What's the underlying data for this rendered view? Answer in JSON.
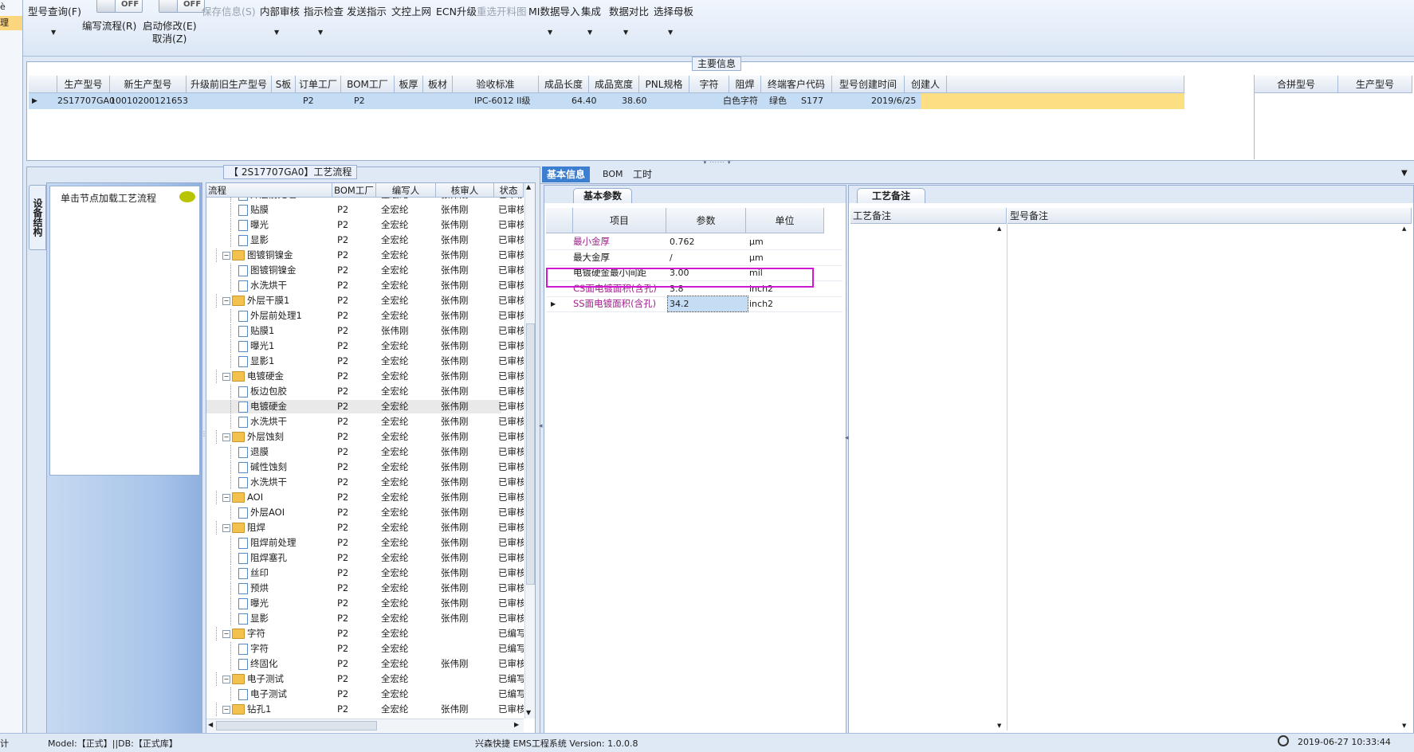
{
  "left_strip": {
    "items": [
      "è",
      "理"
    ]
  },
  "toolbar": {
    "items": [
      {
        "label": "型号查询(F)",
        "has_dropdown": true
      },
      {
        "label": "编写流程(R)"
      },
      {
        "label": "启动修改(E)",
        "sublabel": "取消(Z)"
      },
      {
        "label": "保存信息(S)",
        "disabled": true
      },
      {
        "label": "内部审核",
        "has_dropdown": true
      },
      {
        "label": "指示检查",
        "has_dropdown": true
      },
      {
        "label": "发送指示"
      },
      {
        "label": "文控上网"
      },
      {
        "label": "ECN升级"
      },
      {
        "label": "重选开料图",
        "disabled": true
      },
      {
        "label": "MI数据导入",
        "has_dropdown": true
      },
      {
        "label": "集成",
        "has_dropdown": true
      },
      {
        "label": "数据对比",
        "has_dropdown": true
      },
      {
        "label": "选择母板",
        "has_dropdown": true
      }
    ],
    "toggle1": "OFF",
    "toggle2": "OFF"
  },
  "main_info": {
    "title": "主要信息",
    "headers": [
      "生产型号",
      "新生产型号",
      "升级前旧生产型号",
      "S板",
      "订单工厂",
      "BOM工厂",
      "板厚",
      "板材",
      "验收标准",
      "成品长度",
      "成品宽度",
      "PNL规格",
      "字符",
      "阻焊",
      "终端客户代码",
      "型号创建时间",
      "创建人"
    ],
    "row": [
      "2S17707GA0",
      "10010200121653",
      "",
      "",
      "P2",
      "P2",
      "",
      "",
      "IPC-6012 II级",
      "64.40",
      "38.60",
      "",
      "白色字符",
      "绿色",
      "S177",
      "2019/6/25",
      ""
    ],
    "right_headers": [
      "合拼型号",
      "生产型号"
    ]
  },
  "process": {
    "title": "【 2S17707GA0】工艺流程",
    "side_tab": "设备结构",
    "load_hint": "单击节点加载工艺流程",
    "headers": [
      "流程",
      "BOM工厂",
      "编写人",
      "核审人",
      "状态"
    ],
    "rows": [
      {
        "name": "外层前处理",
        "level": 2,
        "bom": "P2",
        "writer": "全宏纶",
        "reviewer": "张伟刚",
        "status": "已审核"
      },
      {
        "name": "贴膜",
        "level": 2,
        "bom": "P2",
        "writer": "全宏纶",
        "reviewer": "张伟刚",
        "status": "已审核"
      },
      {
        "name": "曝光",
        "level": 2,
        "bom": "P2",
        "writer": "全宏纶",
        "reviewer": "张伟刚",
        "status": "已审核"
      },
      {
        "name": "显影",
        "level": 2,
        "bom": "P2",
        "writer": "全宏纶",
        "reviewer": "张伟刚",
        "status": "已审核"
      },
      {
        "name": "图镀铜镍金",
        "level": 1,
        "bom": "P2",
        "writer": "全宏纶",
        "reviewer": "张伟刚",
        "status": "已审核"
      },
      {
        "name": "图镀铜镍金",
        "level": 2,
        "bom": "P2",
        "writer": "全宏纶",
        "reviewer": "张伟刚",
        "status": "已审核"
      },
      {
        "name": "水洗烘干",
        "level": 2,
        "bom": "P2",
        "writer": "全宏纶",
        "reviewer": "张伟刚",
        "status": "已审核"
      },
      {
        "name": "外层干膜1",
        "level": 1,
        "bom": "P2",
        "writer": "全宏纶",
        "reviewer": "张伟刚",
        "status": "已审核"
      },
      {
        "name": "外层前处理1",
        "level": 2,
        "bom": "P2",
        "writer": "全宏纶",
        "reviewer": "张伟刚",
        "status": "已审核"
      },
      {
        "name": "贴膜1",
        "level": 2,
        "bom": "P2",
        "writer": "张伟刚",
        "reviewer": "张伟刚",
        "status": "已审核"
      },
      {
        "name": "曝光1",
        "level": 2,
        "bom": "P2",
        "writer": "全宏纶",
        "reviewer": "张伟刚",
        "status": "已审核"
      },
      {
        "name": "显影1",
        "level": 2,
        "bom": "P2",
        "writer": "全宏纶",
        "reviewer": "张伟刚",
        "status": "已审核"
      },
      {
        "name": "电镀硬金",
        "level": 1,
        "bom": "P2",
        "writer": "全宏纶",
        "reviewer": "张伟刚",
        "status": "已审核"
      },
      {
        "name": "板边包胶",
        "level": 2,
        "bom": "P2",
        "writer": "全宏纶",
        "reviewer": "张伟刚",
        "status": "已审核"
      },
      {
        "name": "电镀硬金",
        "level": 2,
        "bom": "P2",
        "writer": "全宏纶",
        "reviewer": "张伟刚",
        "status": "已审核",
        "selected": true
      },
      {
        "name": "水洗烘干",
        "level": 2,
        "bom": "P2",
        "writer": "全宏纶",
        "reviewer": "张伟刚",
        "status": "已审核"
      },
      {
        "name": "外层蚀刻",
        "level": 1,
        "bom": "P2",
        "writer": "全宏纶",
        "reviewer": "张伟刚",
        "status": "已审核"
      },
      {
        "name": "退膜",
        "level": 2,
        "bom": "P2",
        "writer": "全宏纶",
        "reviewer": "张伟刚",
        "status": "已审核"
      },
      {
        "name": "碱性蚀刻",
        "level": 2,
        "bom": "P2",
        "writer": "全宏纶",
        "reviewer": "张伟刚",
        "status": "已审核"
      },
      {
        "name": "水洗烘干",
        "level": 2,
        "bom": "P2",
        "writer": "全宏纶",
        "reviewer": "张伟刚",
        "status": "已审核"
      },
      {
        "name": "AOI",
        "level": 1,
        "bom": "P2",
        "writer": "全宏纶",
        "reviewer": "张伟刚",
        "status": "已审核"
      },
      {
        "name": "外层AOI",
        "level": 2,
        "bom": "P2",
        "writer": "全宏纶",
        "reviewer": "张伟刚",
        "status": "已审核"
      },
      {
        "name": "阻焊",
        "level": 1,
        "bom": "P2",
        "writer": "全宏纶",
        "reviewer": "张伟刚",
        "status": "已审核"
      },
      {
        "name": "阻焊前处理",
        "level": 2,
        "bom": "P2",
        "writer": "全宏纶",
        "reviewer": "张伟刚",
        "status": "已审核"
      },
      {
        "name": "阻焊塞孔",
        "level": 2,
        "bom": "P2",
        "writer": "全宏纶",
        "reviewer": "张伟刚",
        "status": "已审核"
      },
      {
        "name": "丝印",
        "level": 2,
        "bom": "P2",
        "writer": "全宏纶",
        "reviewer": "张伟刚",
        "status": "已审核"
      },
      {
        "name": "预烘",
        "level": 2,
        "bom": "P2",
        "writer": "全宏纶",
        "reviewer": "张伟刚",
        "status": "已审核"
      },
      {
        "name": "曝光",
        "level": 2,
        "bom": "P2",
        "writer": "全宏纶",
        "reviewer": "张伟刚",
        "status": "已审核"
      },
      {
        "name": "显影",
        "level": 2,
        "bom": "P2",
        "writer": "全宏纶",
        "reviewer": "张伟刚",
        "status": "已审核"
      },
      {
        "name": "字符",
        "level": 1,
        "bom": "P2",
        "writer": "全宏纶",
        "reviewer": "",
        "status": "已编写"
      },
      {
        "name": "字符",
        "level": 2,
        "bom": "P2",
        "writer": "全宏纶",
        "reviewer": "",
        "status": "已编写"
      },
      {
        "name": "终固化",
        "level": 2,
        "bom": "P2",
        "writer": "全宏纶",
        "reviewer": "张伟刚",
        "status": "已审核"
      },
      {
        "name": "电子测试",
        "level": 1,
        "bom": "P2",
        "writer": "全宏纶",
        "reviewer": "",
        "status": "已编写"
      },
      {
        "name": "电子测试",
        "level": 2,
        "bom": "P2",
        "writer": "全宏纶",
        "reviewer": "",
        "status": "已编写"
      },
      {
        "name": "钻孔1",
        "level": 1,
        "bom": "P2",
        "writer": "全宏纶",
        "reviewer": "张伟刚",
        "status": "已审核"
      }
    ]
  },
  "detail": {
    "tabs": [
      "基本信息",
      "BOM",
      "工时"
    ],
    "params_tab": "基本参数",
    "params_headers": [
      "项目",
      "参数",
      "单位"
    ],
    "params": [
      {
        "item": "最小金厚",
        "value": "0.762",
        "unit": "μm",
        "color": "#a0208c"
      },
      {
        "item": "最大金厚",
        "value": "/",
        "unit": "μm",
        "color": "#1e1e1e"
      },
      {
        "item": "电镀硬金最小间距",
        "value": "3.00",
        "unit": "mil",
        "color": "#1e1e1e",
        "highlighted": true
      },
      {
        "item": "CS面电镀面积(含孔)",
        "value": "3.8",
        "unit": "inch2",
        "color": "#a0208c"
      },
      {
        "item": "SS面电镀面积(含孔)",
        "value": "34.2",
        "unit": "inch2",
        "color": "#a0208c",
        "current": true
      }
    ],
    "remarks_tab": "工艺备注",
    "remarks_headers": [
      "工艺备注",
      "型号备注"
    ]
  },
  "status_bar": {
    "left_edge": "计",
    "model_db": "Model:【正式】||DB:【正式库】",
    "app_version": "兴森快捷 EMS工程系统 Version: 1.0.0.8",
    "datetime": "2019-06-27 10:33:44"
  },
  "colors": {
    "selection_row": "#c5dcf5",
    "highlight_box": "#d01ad0",
    "accent_tab": "#3c7fd0",
    "orange_row": "#fcdf82"
  }
}
